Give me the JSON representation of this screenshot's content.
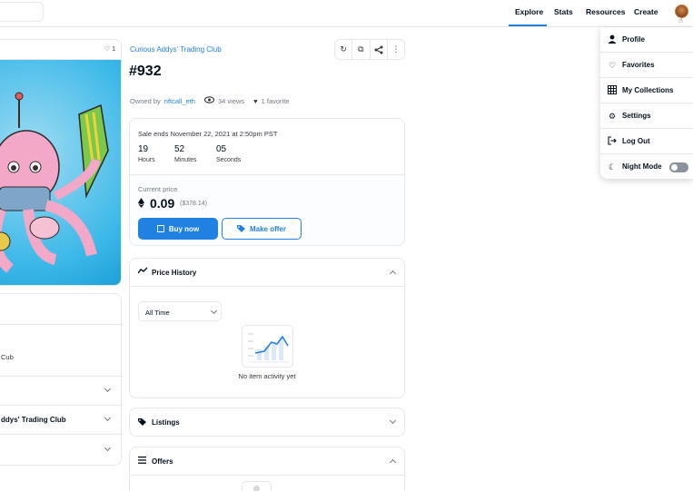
{
  "nav": {
    "links": [
      "Explore",
      "Stats",
      "Resources",
      "Create"
    ],
    "active": "Explore"
  },
  "left_panel": {
    "favorite_count": "1",
    "rows": [
      {
        "text": "Cub"
      },
      {
        "text": ""
      },
      {
        "text": "ddys' Trading Club"
      },
      {
        "text": ""
      }
    ]
  },
  "asset": {
    "collection_name": "Curious Addys' Trading Club",
    "title": "#932",
    "owned_by_label": "Owned by",
    "owner": "nftcall_eth",
    "views": "34 views",
    "favorites": "1 favorite"
  },
  "sale": {
    "ends_text": "Sale ends November 22, 2021 at 2:50pm PST",
    "countdown": [
      {
        "value": "19",
        "label": "Hours"
      },
      {
        "value": "52",
        "label": "Minutes"
      },
      {
        "value": "05",
        "label": "Seconds"
      }
    ],
    "current_price_label": "Current price",
    "price": "0.09",
    "price_usd": "($378.14)",
    "buy_label": "Buy now",
    "offer_label": "Make offer"
  },
  "price_history": {
    "title": "Price History",
    "filter_value": "All Time",
    "empty_text": "No item activity yet"
  },
  "listings": {
    "title": "Listings"
  },
  "offers": {
    "title": "Offers"
  },
  "menu": {
    "items": [
      {
        "label": "Profile",
        "icon": "user-icon"
      },
      {
        "label": "Favorites",
        "icon": "heart-icon"
      },
      {
        "label": "My Collections",
        "icon": "grid-icon"
      },
      {
        "label": "Settings",
        "icon": "gear-icon"
      },
      {
        "label": "Log Out",
        "icon": "logout-icon"
      },
      {
        "label": "Night Mode",
        "icon": "moon-icon"
      }
    ],
    "night_mode_on": false
  },
  "colors": {
    "accent": "#2081e2",
    "text": "#04111d",
    "muted": "#707a83",
    "border": "#e5e8eb"
  }
}
